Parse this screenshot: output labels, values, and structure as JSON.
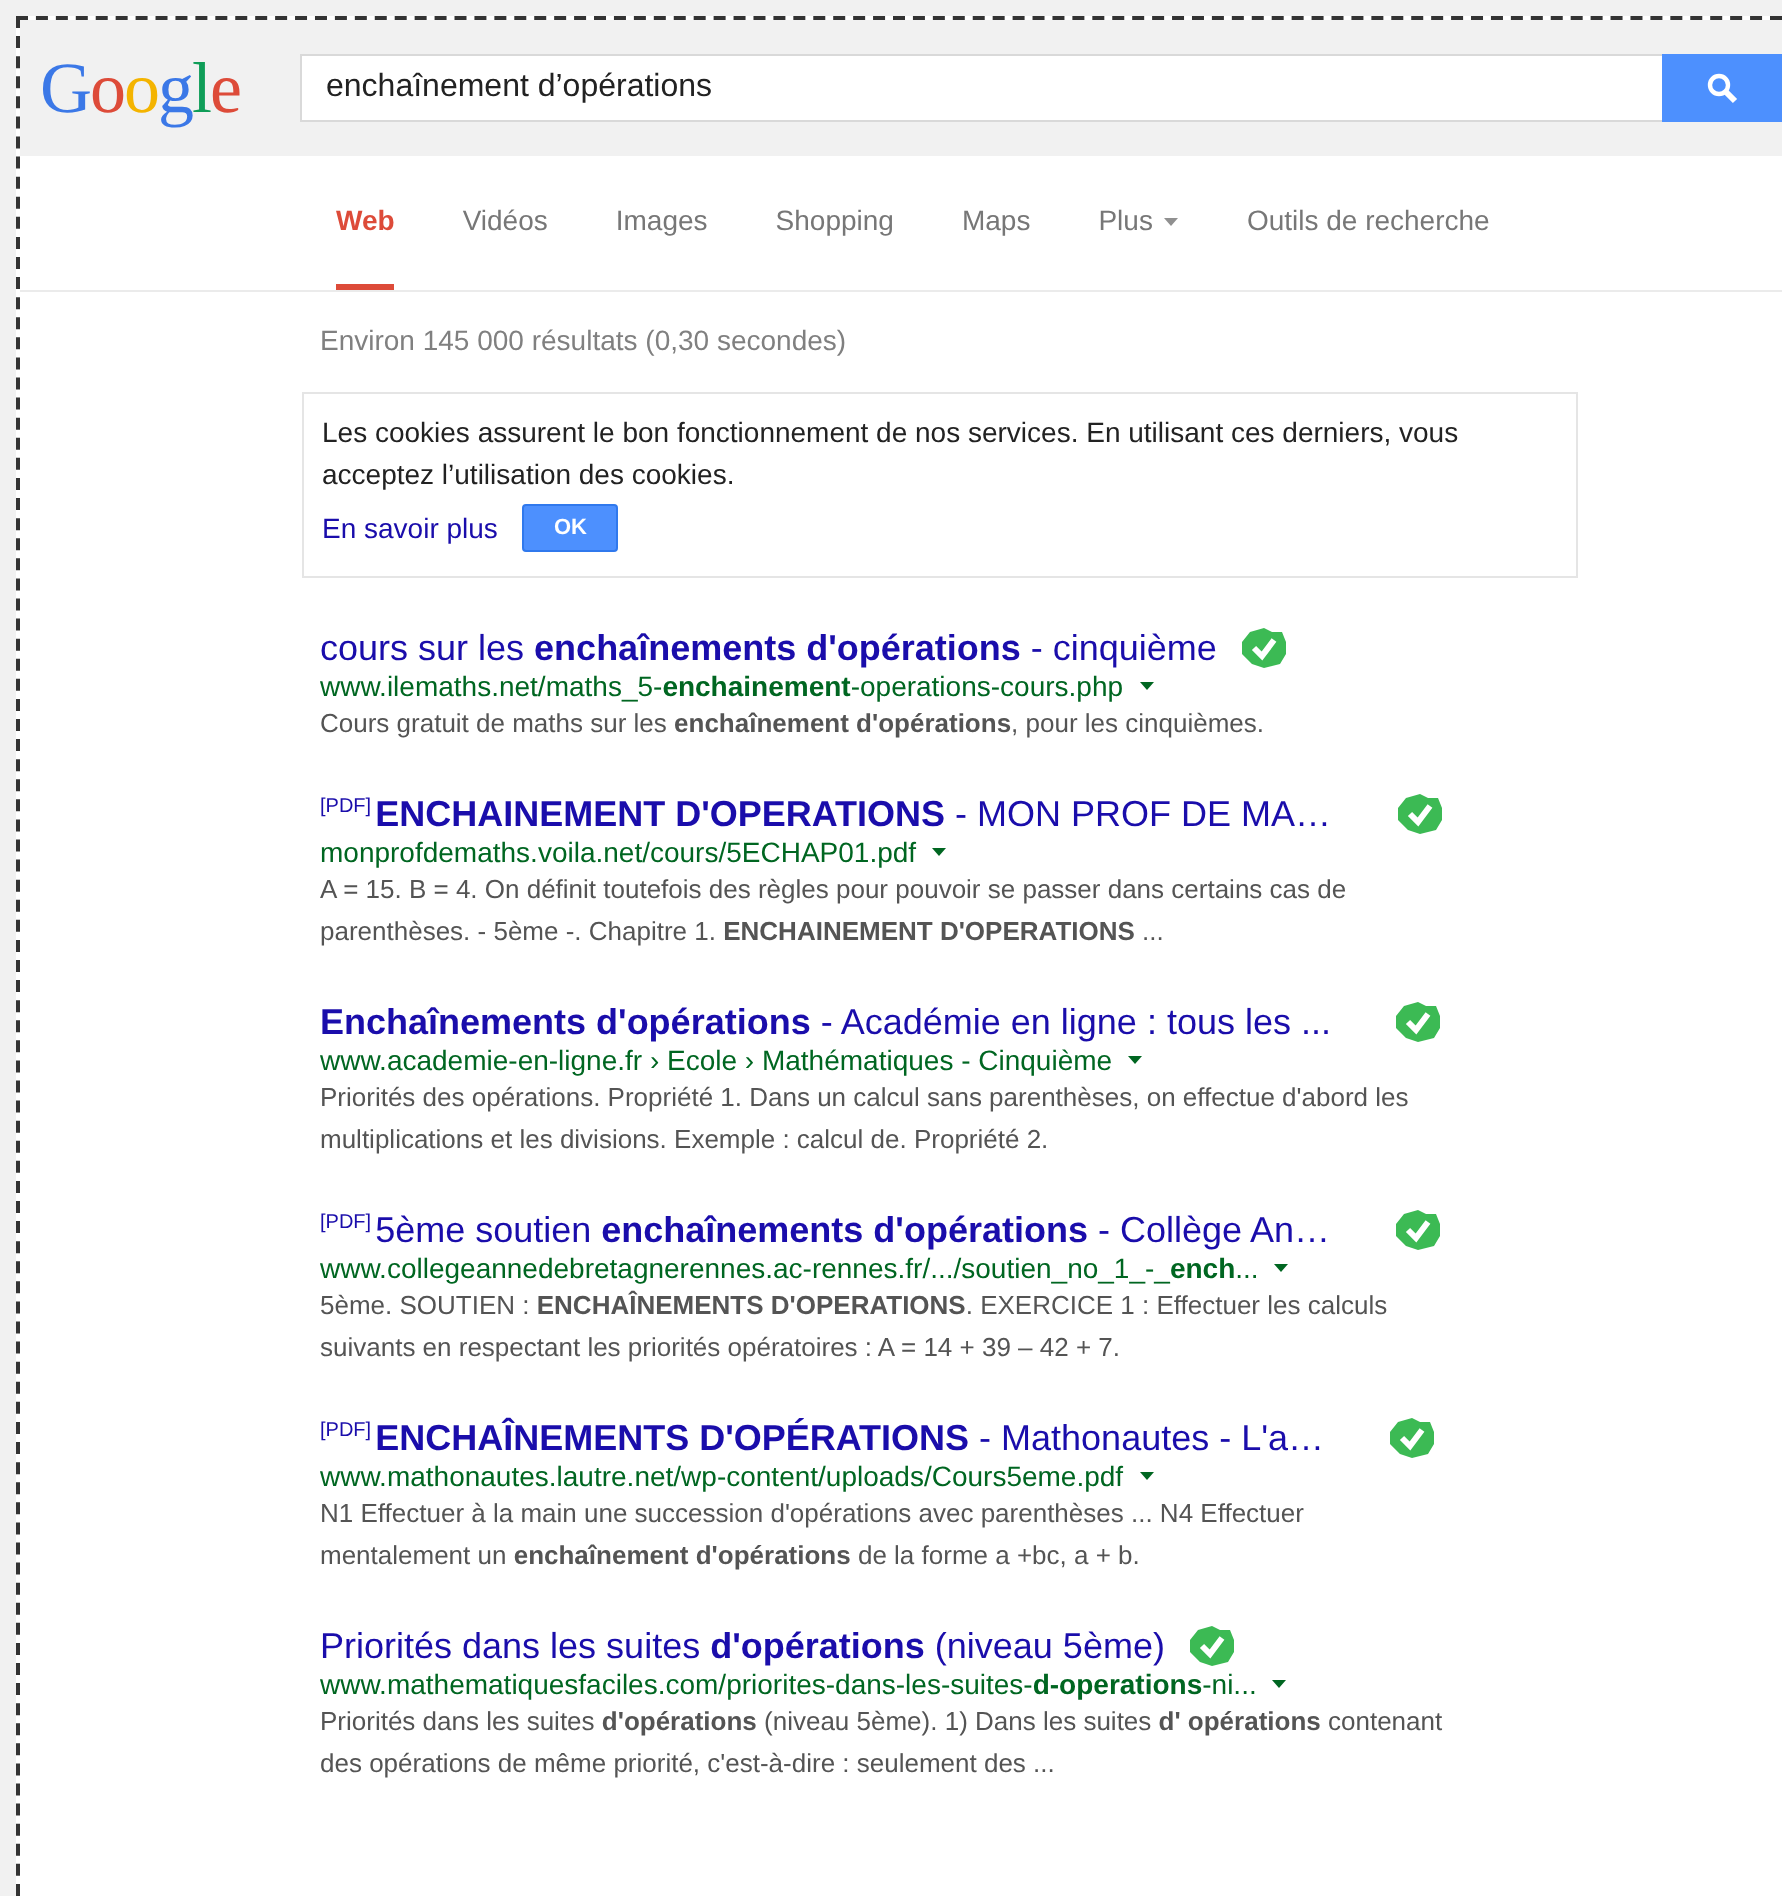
{
  "logo": "Google",
  "search": {
    "value": "enchaînement d’opérations"
  },
  "tabs": [
    {
      "label": "Web",
      "selected": true,
      "dropdown": false
    },
    {
      "label": "Vidéos",
      "selected": false,
      "dropdown": false
    },
    {
      "label": "Images",
      "selected": false,
      "dropdown": false
    },
    {
      "label": "Shopping",
      "selected": false,
      "dropdown": false
    },
    {
      "label": "Maps",
      "selected": false,
      "dropdown": false
    },
    {
      "label": "Plus",
      "selected": false,
      "dropdown": true
    },
    {
      "label": "Outils de recherche",
      "selected": false,
      "dropdown": false
    }
  ],
  "result_stats": "Environ 145 000 résultats (0,30 secondes)",
  "cookie_notice": {
    "text": "Les cookies assurent le bon fonctionnement de nos services. En utilisant ces derniers, vous acceptez l’utilisation des cookies.",
    "link": "En savoir plus",
    "button": "OK"
  },
  "results": [
    {
      "title": "cours sur les **enchaînements d'opérations** - cinquième",
      "url": "www.ilemaths.net/maths_5-**enchainement**-operations-cours.php",
      "snippet": "Cours gratuit de maths sur les **enchaînement d'opérations**, pour les cinquièmes.",
      "verified": true
    },
    {
      "tag": "[PDF]",
      "title": "**ENCHAINEMENT D'OPERATIONS** - MON PROF DE MA…",
      "url": "monprofdemaths.voila.net/cours/5ECHAP01.pdf",
      "snippet": "A = 15. B = 4. On définit toutefois des règles pour pouvoir se passer dans certains cas de parenthèses. - 5ème -. Chapitre 1. **ENCHAINEMENT D'OPERATIONS** ...",
      "verified": true
    },
    {
      "title": "**Enchaînements d'opérations** - Académie en ligne : tous les ...",
      "url": "www.academie-en-ligne.fr › Ecole › Mathématiques - Cinquième",
      "snippet": "Priorités des opérations. Propriété 1. Dans un calcul sans parenthèses, on effectue d'abord les multiplications et les divisions. Exemple : calcul de. Propriété 2.",
      "verified": true
    },
    {
      "tag": "[PDF]",
      "title": "5ème soutien **enchaînements d'opérations** - Collège An…",
      "url": "www.collegeannedebretagnerennes.ac-rennes.fr/.../soutien_no_1_-_**ench**...",
      "snippet": "5ème. SOUTIEN : **ENCHAÎNEMENTS D'OPERATIONS**. EXERCICE 1 : Effectuer les calculs suivants en respectant les priorités opératoires : A = 14 + 39 – 42 + 7.",
      "verified": true
    },
    {
      "tag": "[PDF]",
      "title": "**ENCHAÎNEMENTS D'OPÉRATIONS** - Mathonautes - L'a…",
      "url": "www.mathonautes.lautre.net/wp-content/uploads/Cours5eme.pdf",
      "snippet": "N1 Effectuer à la main une succession d'opérations avec parenthèses ... N4 Effectuer mentalement un **enchaînement d'opérations** de la forme a +bc, a + b.",
      "verified": true
    },
    {
      "title": "Priorités dans les suites **d'opérations** (niveau 5ème)",
      "url": "www.mathematiquesfaciles.com/priorites-dans-les-suites-**d-operations**-ni...",
      "snippet": "Priorités dans les suites **d'opérations** (niveau 5ème). 1) Dans les suites **d' opérations** contenant des opérations de même priorité, c'est-à-dire : seulement des ...",
      "verified": true
    }
  ]
}
